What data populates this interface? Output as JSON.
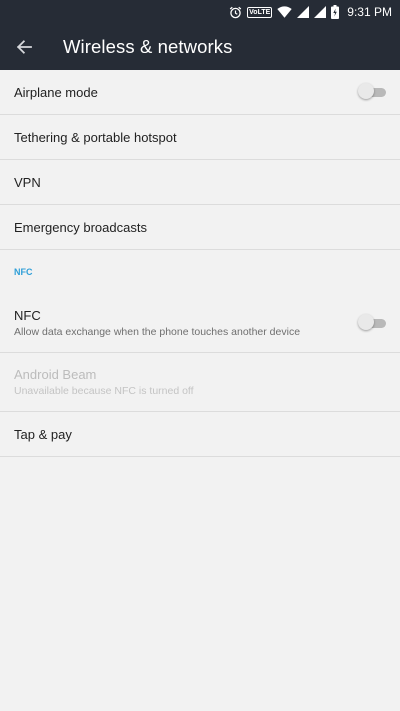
{
  "status_bar": {
    "time": "9:31 PM",
    "volte_label": "VoLTE",
    "icons": [
      "alarm-icon",
      "volte-icon",
      "wifi-icon",
      "signal-icon",
      "signal-icon",
      "battery-charging-icon"
    ]
  },
  "app_bar": {
    "title": "Wireless & networks",
    "back_icon": "arrow-left-icon"
  },
  "settings": {
    "airplane_mode": {
      "title": "Airplane mode",
      "toggle_on": false
    },
    "tethering": {
      "title": "Tethering & portable hotspot"
    },
    "vpn": {
      "title": "VPN"
    },
    "emergency": {
      "title": "Emergency broadcasts"
    },
    "nfc_section": {
      "header": "NFC"
    },
    "nfc": {
      "title": "NFC",
      "subtitle": "Allow data exchange when the phone touches another device",
      "toggle_on": false
    },
    "android_beam": {
      "title": "Android Beam",
      "subtitle": "Unavailable because NFC is turned off",
      "enabled": false
    },
    "tap_pay": {
      "title": "Tap & pay"
    }
  },
  "colors": {
    "bar_bg": "#262c36",
    "page_bg": "#f2f2f2",
    "accent": "#2f9fd8"
  }
}
